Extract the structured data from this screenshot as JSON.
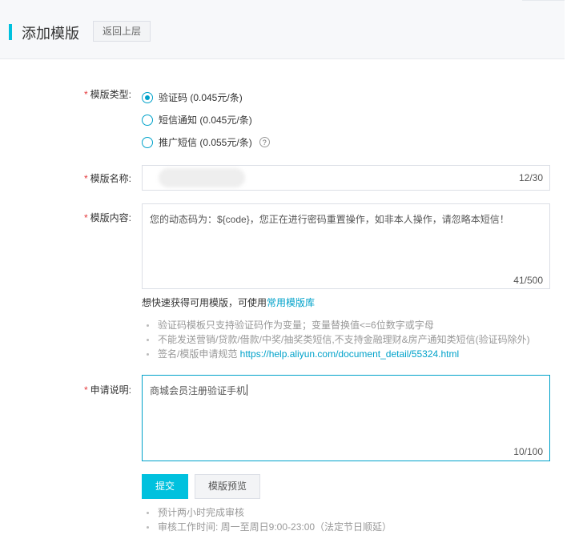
{
  "header": {
    "title": "添加模版",
    "back_label": "返回上层"
  },
  "form": {
    "type": {
      "label": "模版类型:",
      "options": [
        {
          "label": "验证码 (0.045元/条)",
          "selected": true
        },
        {
          "label": "短信通知 (0.045元/条)",
          "selected": false
        },
        {
          "label": "推广短信 (0.055元/条)",
          "selected": false
        }
      ],
      "help_icon": "?"
    },
    "name": {
      "label": "模版名称:",
      "counter": "12/30"
    },
    "content": {
      "label": "模版内容:",
      "value": "您的动态码为：${code}，您正在进行密码重置操作，如非本人操作，请忽略本短信！",
      "counter": "41/500",
      "quick_text": "想快速获得可用模版，可使用",
      "quick_link": "常用模版库",
      "tips": [
        "验证码模板只支持验证码作为变量；变量替换值<=6位数字或字母",
        "不能发送营销/贷款/借款/中奖/抽奖类短信,不支持金融理财&房产通知类短信(验证码除外)"
      ],
      "spec_text": "签名/模版申请规范 ",
      "spec_link": "https://help.aliyun.com/document_detail/55324.html"
    },
    "reason": {
      "label": "申请说明:",
      "value": "商城会员注册验证手机",
      "counter": "10/100"
    }
  },
  "actions": {
    "submit_label": "提交",
    "preview_label": "模版预览"
  },
  "footer_tips": [
    "预计两小时完成审核",
    "审核工作时间: 周一至周日9:00-23:00（法定节日顺延）"
  ]
}
